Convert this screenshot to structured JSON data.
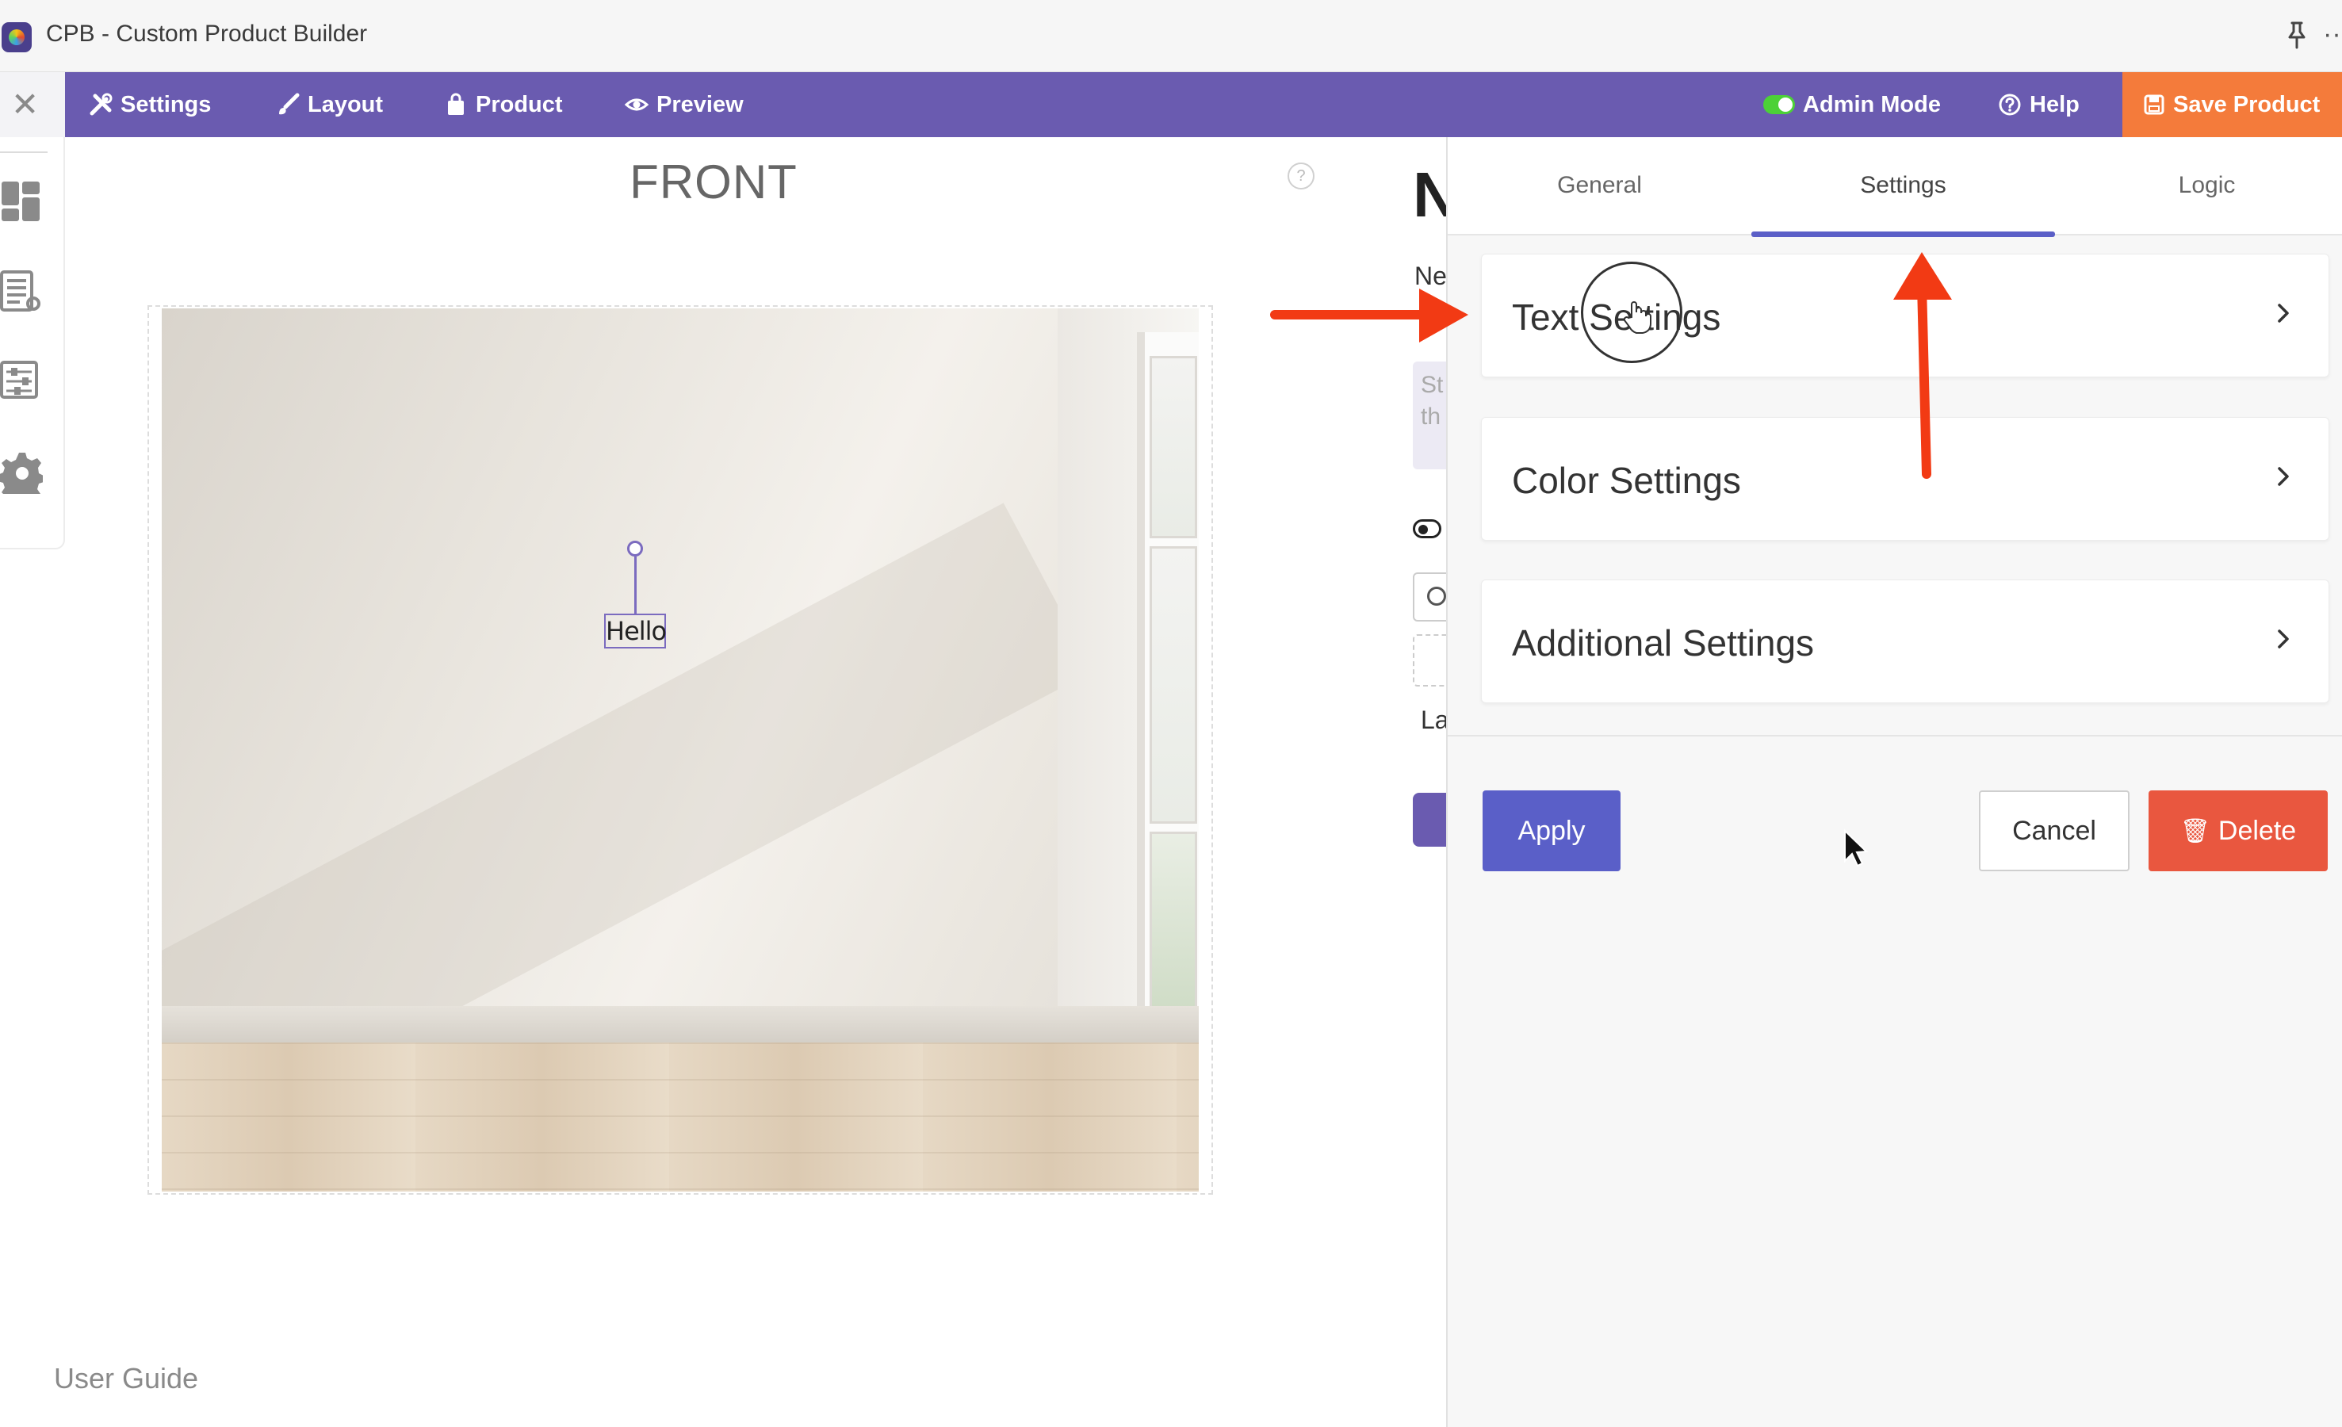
{
  "window": {
    "title": "CPB - Custom Product Builder",
    "more_label": "···"
  },
  "toolbar": {
    "close_label": "✕",
    "nav": [
      {
        "label": "Settings",
        "icon": "tools-icon"
      },
      {
        "label": "Layout",
        "icon": "brush-icon"
      },
      {
        "label": "Product",
        "icon": "bag-icon"
      },
      {
        "label": "Preview",
        "icon": "eye-icon"
      }
    ],
    "admin_mode": {
      "label": "Admin Mode",
      "enabled": true
    },
    "help_label": "Help",
    "save_label": "Save Product",
    "colors": {
      "bar": "#6a5bb0",
      "save": "#f47b3b",
      "toggle": "#4cd137"
    }
  },
  "left_rail": {
    "icons": [
      "dashboard-icon",
      "list-icon",
      "sliders-icon",
      "gear-icon"
    ]
  },
  "canvas": {
    "side_label": "FRONT",
    "help_symbol": "?",
    "text_element": "Hello"
  },
  "middle_column": {
    "heading_fragment": "N",
    "label_fragment": "Ne",
    "placeholder_fragment_1": "St",
    "placeholder_fragment_2": "th",
    "label_fragment_2": "La"
  },
  "footer": {
    "user_guide": "User Guide"
  },
  "panel": {
    "tabs": [
      {
        "label": "General",
        "active": false
      },
      {
        "label": "Settings",
        "active": true
      },
      {
        "label": "Logic",
        "active": false
      }
    ],
    "sections": [
      {
        "label": "Text Settings"
      },
      {
        "label": "Color Settings"
      },
      {
        "label": "Additional Settings"
      }
    ],
    "buttons": {
      "apply": "Apply",
      "cancel": "Cancel",
      "delete": "Delete"
    },
    "colors": {
      "active_tab": "#5b5fc7",
      "apply": "#5a5fc8",
      "delete": "#e9573f"
    }
  },
  "annotations": {
    "arrow_color": "#f23a14"
  }
}
